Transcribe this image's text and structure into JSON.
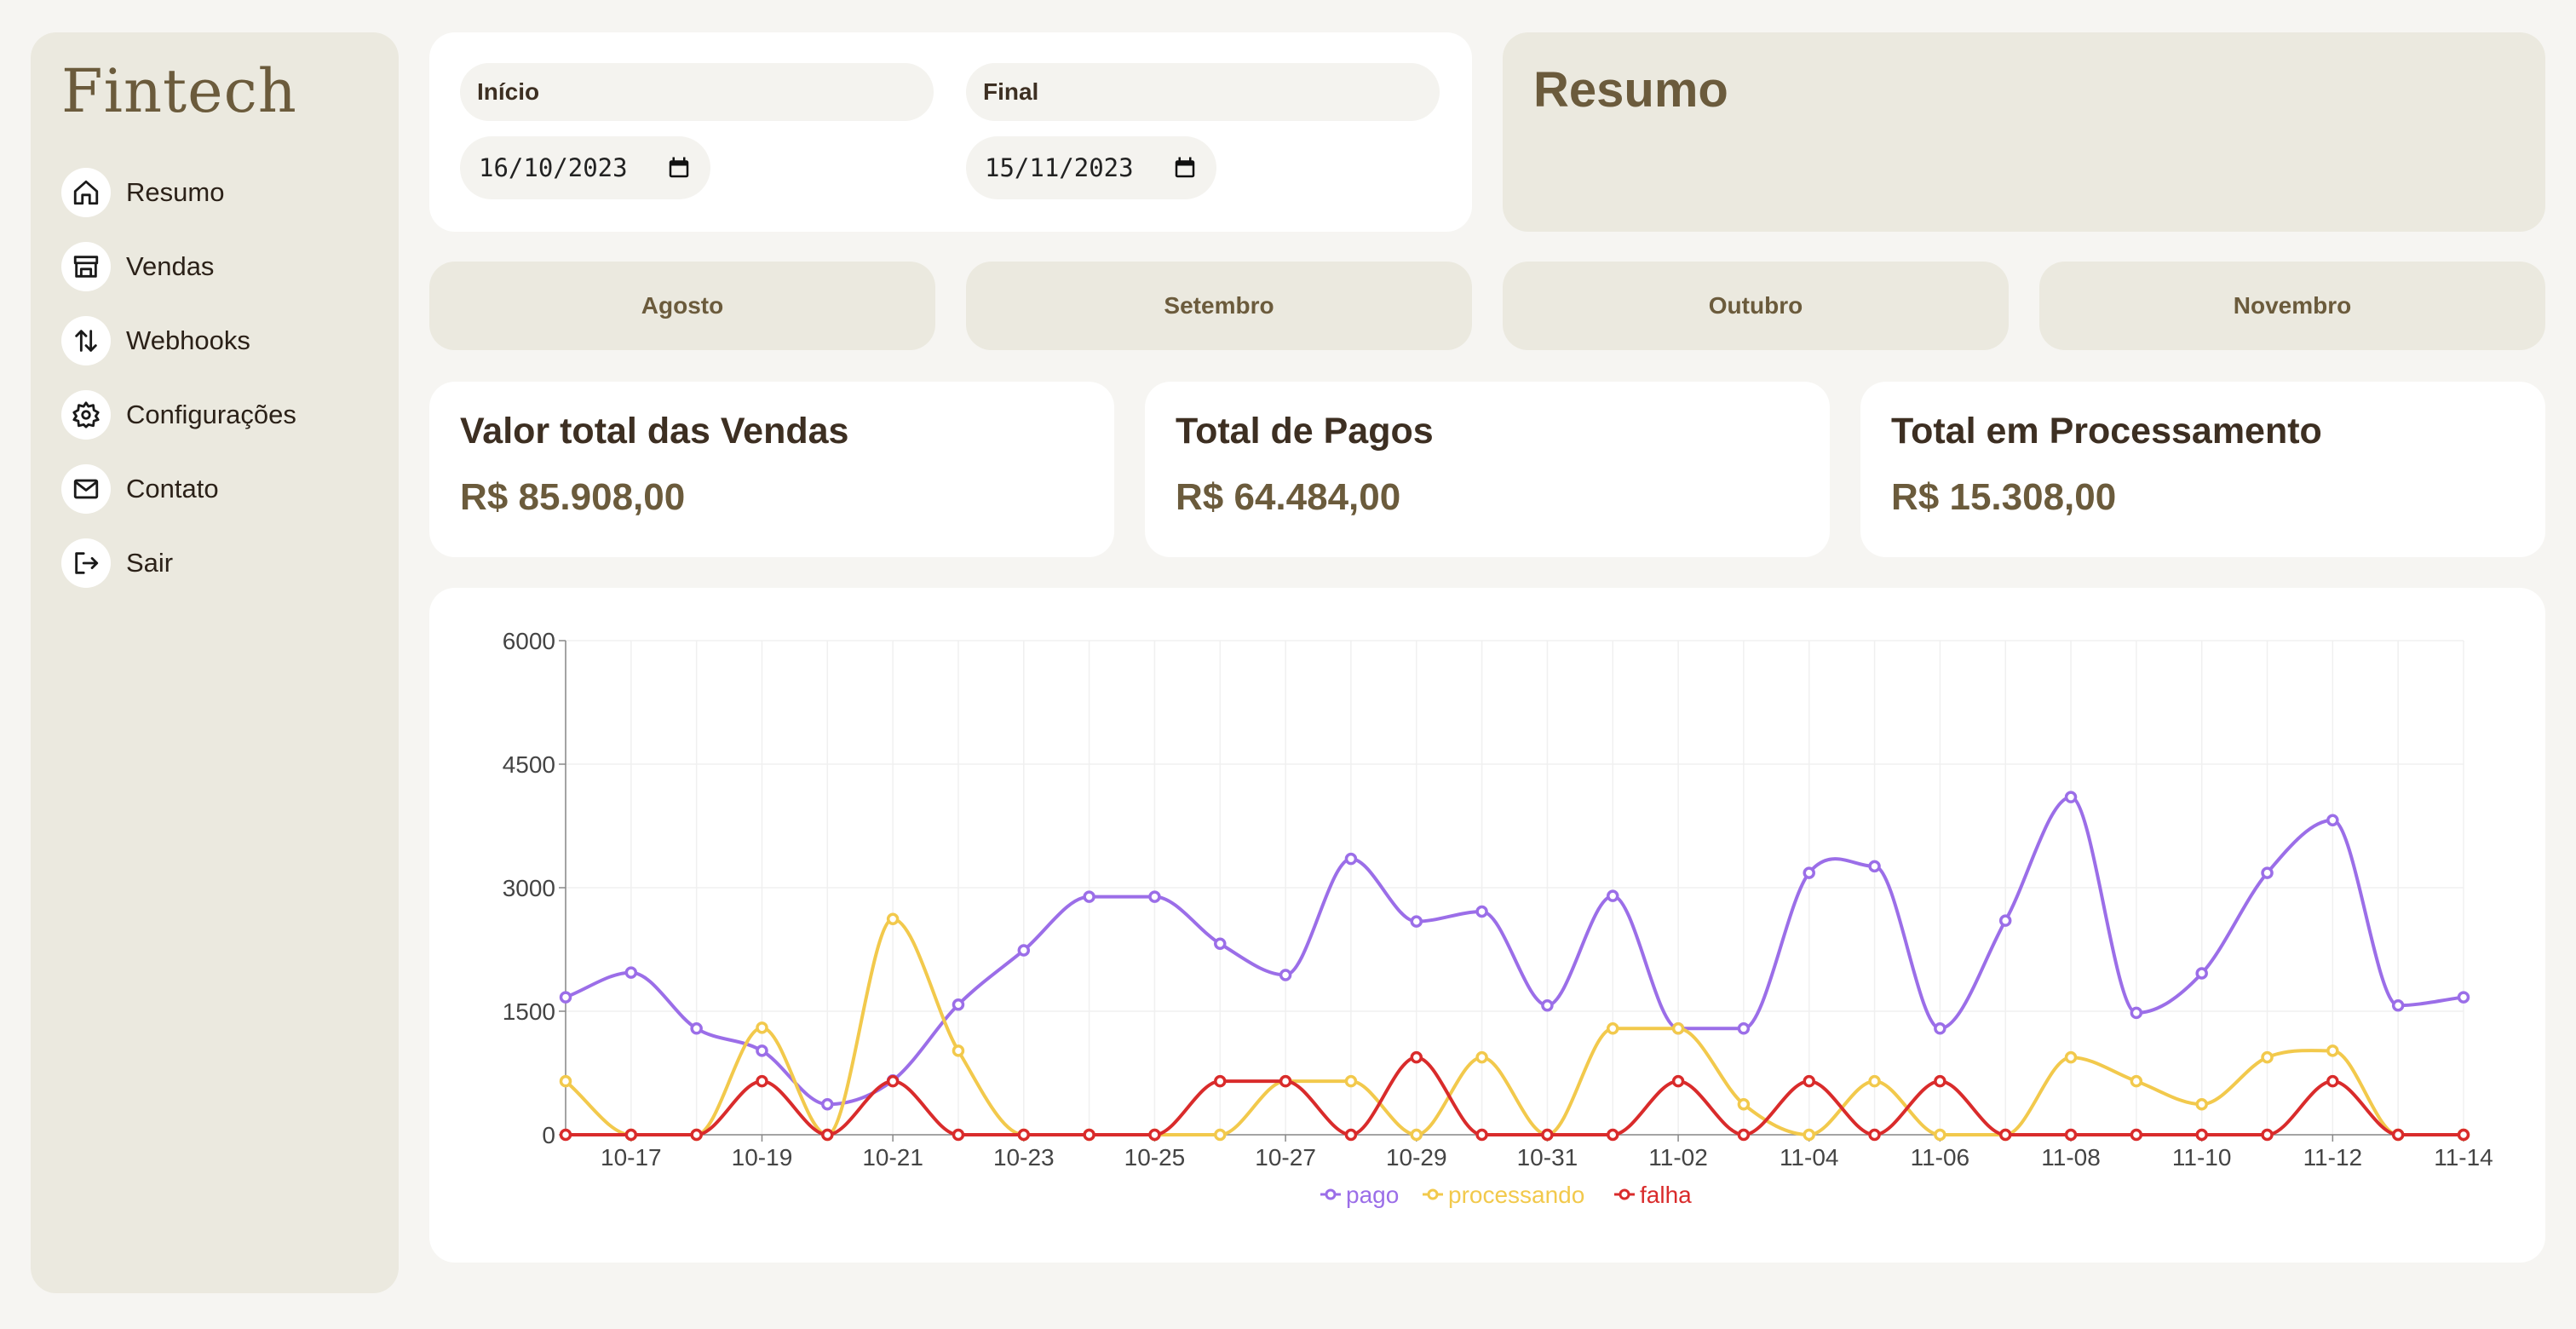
{
  "app": {
    "logo": "Fintech"
  },
  "sidebar": {
    "items": [
      {
        "label": "Resumo",
        "icon": "home-icon"
      },
      {
        "label": "Vendas",
        "icon": "store-icon"
      },
      {
        "label": "Webhooks",
        "icon": "arrows-updown-icon"
      },
      {
        "label": "Configurações",
        "icon": "gear-icon"
      },
      {
        "label": "Contato",
        "icon": "mail-icon"
      },
      {
        "label": "Sair",
        "icon": "logout-icon"
      }
    ]
  },
  "dates": {
    "start_label": "Início",
    "start_value": "16/10/2023",
    "end_label": "Final",
    "end_value": "15/11/2023"
  },
  "resumo": {
    "title": "Resumo"
  },
  "months": [
    "Agosto",
    "Setembro",
    "Outubro",
    "Novembro"
  ],
  "totals": [
    {
      "title": "Valor total das Vendas",
      "value": "R$ 85.908,00"
    },
    {
      "title": "Total de Pagos",
      "value": "R$ 64.484,00"
    },
    {
      "title": "Total em Processamento",
      "value": "R$ 15.308,00"
    }
  ],
  "colors": {
    "pago": "#9b6ee8",
    "processando": "#f2c94c",
    "falha": "#d92b2b",
    "accent": "#6b5b3c",
    "panel": "#ebe9df"
  },
  "chart_data": {
    "type": "line",
    "x": [
      "10-16",
      "10-17",
      "10-18",
      "10-19",
      "10-20",
      "10-21",
      "10-22",
      "10-23",
      "10-24",
      "10-25",
      "10-26",
      "10-27",
      "10-28",
      "10-29",
      "10-30",
      "10-31",
      "11-01",
      "11-02",
      "11-03",
      "11-04",
      "11-05",
      "11-06",
      "11-07",
      "11-08",
      "11-09",
      "11-10",
      "11-11",
      "11-12",
      "11-13",
      "11-14"
    ],
    "xticks": [
      "10-17",
      "10-19",
      "10-21",
      "10-23",
      "10-25",
      "10-27",
      "10-29",
      "10-31",
      "11-02",
      "11-04",
      "11-06",
      "11-08",
      "11-10",
      "11-12",
      "11-14"
    ],
    "yticks": [
      0,
      1500,
      3000,
      4500,
      6000
    ],
    "ylim": [
      0,
      6000
    ],
    "grid": true,
    "legend_position": "bottom",
    "series": [
      {
        "name": "pago",
        "values": [
          1670,
          1970,
          1290,
          1020,
          370,
          660,
          1580,
          2240,
          2890,
          2890,
          2320,
          1940,
          3350,
          2590,
          2710,
          1570,
          2900,
          1290,
          1290,
          3180,
          3260,
          1290,
          2600,
          4100,
          1480,
          1960,
          3180,
          3820,
          1570,
          1670
        ]
      },
      {
        "name": "processando",
        "values": [
          650,
          0,
          0,
          1300,
          0,
          2620,
          1020,
          0,
          0,
          0,
          0,
          650,
          650,
          0,
          940,
          0,
          1290,
          1290,
          370,
          0,
          650,
          0,
          0,
          940,
          650,
          370,
          940,
          1020,
          0,
          0
        ]
      },
      {
        "name": "falha",
        "values": [
          0,
          0,
          0,
          650,
          0,
          650,
          0,
          0,
          0,
          0,
          650,
          650,
          0,
          940,
          0,
          0,
          0,
          650,
          0,
          650,
          0,
          650,
          0,
          0,
          0,
          0,
          0,
          650,
          0,
          0
        ]
      }
    ]
  }
}
